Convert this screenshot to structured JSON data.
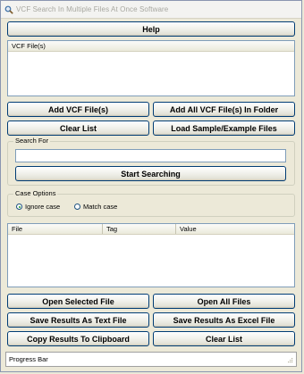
{
  "window": {
    "title": "VCF Search In Multiple Files At Once Software",
    "icon": "app-search-icon"
  },
  "toolbar": {
    "help_label": "Help"
  },
  "vcf_list": {
    "header": "VCF File(s)"
  },
  "file_buttons": {
    "add_vcf": "Add VCF File(s)",
    "add_all_vcf_folder": "Add All VCF File(s) In Folder",
    "clear_list": "Clear List",
    "load_sample": "Load Sample/Example Files"
  },
  "search": {
    "group_label": "Search For",
    "value": "",
    "start_label": "Start Searching"
  },
  "case_options": {
    "group_label": "Case Options",
    "ignore_case": "Ignore case",
    "match_case": "Match case",
    "selected": "Ignore case"
  },
  "results": {
    "columns": [
      "File",
      "Tag",
      "Value"
    ]
  },
  "result_buttons": {
    "open_selected": "Open Selected File",
    "open_all": "Open All Files",
    "save_text": "Save Results As Text File",
    "save_excel": "Save Results As Excel File",
    "copy_clipboard": "Copy Results To Clipboard",
    "clear_list": "Clear List"
  },
  "status": {
    "progress_label": "Progress Bar",
    "progress": 0
  }
}
